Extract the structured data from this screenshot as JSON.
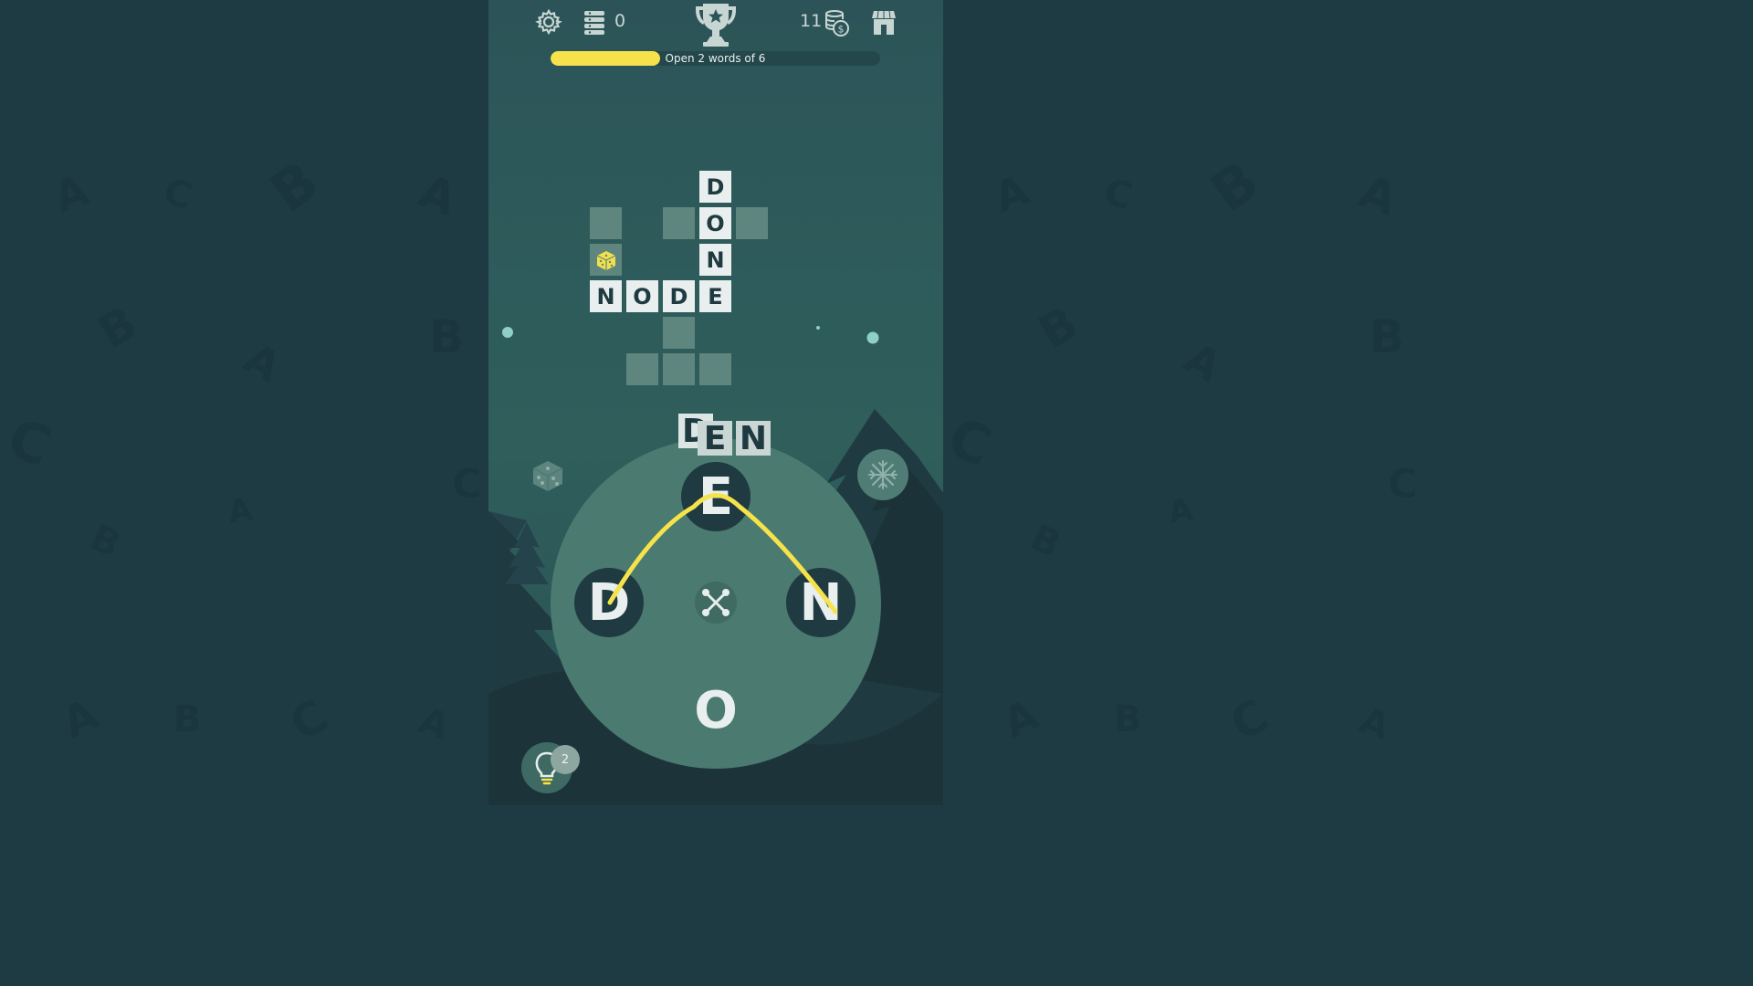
{
  "hud": {
    "settings_icon": "gear-icon",
    "tickets_icon": "ticket-stack-icon",
    "tickets_count": "0",
    "trophy_icon": "trophy-icon",
    "coins_count": "11",
    "coins_icon": "coins-icon",
    "shop_icon": "shop-icon"
  },
  "progress": {
    "label": "Open 2 words of 6",
    "opened": 2,
    "total": 6,
    "fill_color": "#f6e24a"
  },
  "crossword": {
    "letters_found": [
      "D",
      "O",
      "N",
      "N",
      "O",
      "D",
      "E"
    ],
    "words_found": [
      "DONE",
      "NODE"
    ],
    "bonus_icon": "dice-icon"
  },
  "current_word": {
    "letters": [
      "D",
      "E",
      "N"
    ]
  },
  "wheel": {
    "letters": [
      "E",
      "D",
      "N",
      "O"
    ],
    "shuffle_icon": "shuffle-icon",
    "path_color": "#f6e24a"
  },
  "tools": {
    "dice_icon": "dice-icon",
    "snowflake_icon": "snowflake-icon",
    "hint_icon": "lightbulb-icon",
    "hint_count": "2"
  },
  "background": {
    "letters": [
      "A",
      "B",
      "C",
      "A",
      "B",
      "C",
      "A",
      "B",
      "C",
      "A",
      "B",
      "C",
      "A",
      "B",
      "C",
      "A",
      "B",
      "C",
      "A",
      "B",
      "C",
      "A",
      "B",
      "C"
    ]
  }
}
